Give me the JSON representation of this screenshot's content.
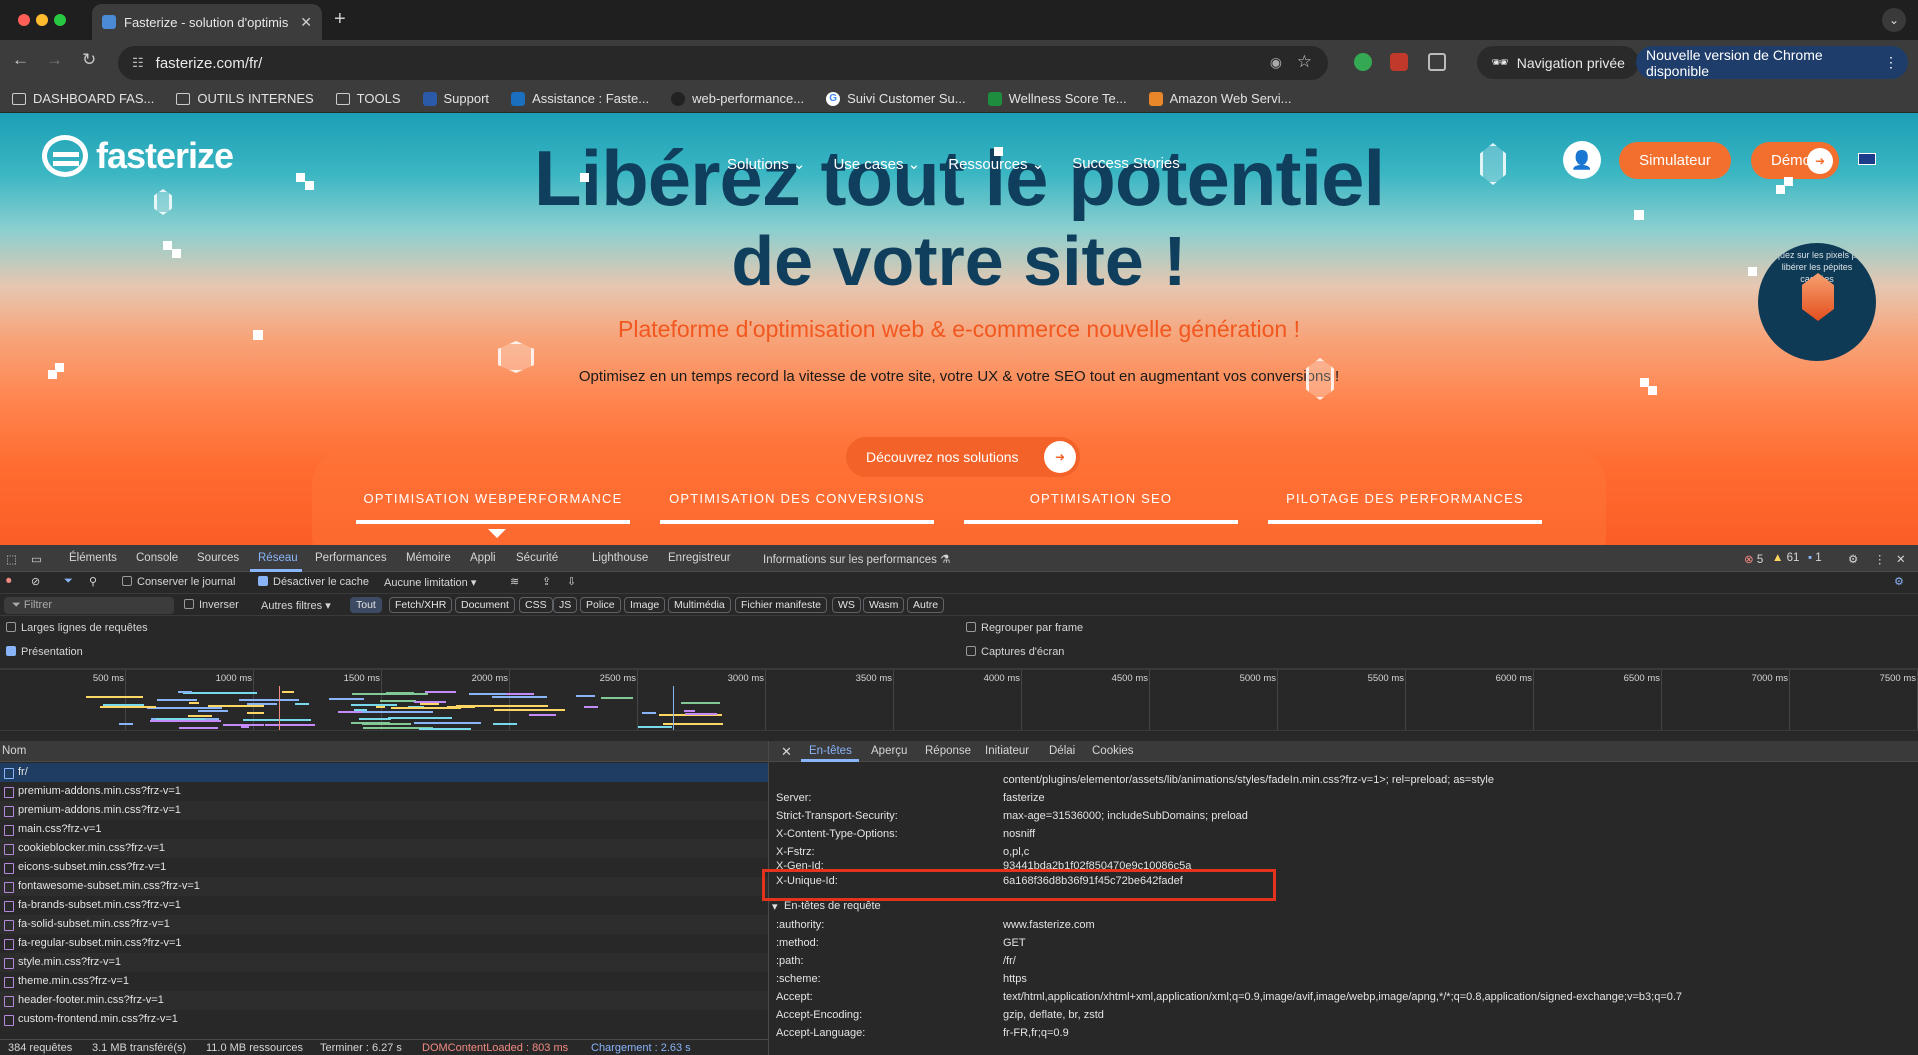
{
  "browser": {
    "tab_title": "Fasterize - solution d'optimis",
    "url": "fasterize.com/fr/",
    "private_label": "Navigation privée",
    "update_label": "Nouvelle version de Chrome disponible",
    "bookmarks": [
      {
        "label": "DASHBOARD FAS...",
        "icon": "folder-icon"
      },
      {
        "label": "OUTILS INTERNES",
        "icon": "folder-icon"
      },
      {
        "label": "TOOLS",
        "icon": "folder-icon"
      },
      {
        "label": "Support",
        "icon": "support-icon"
      },
      {
        "label": "Assistance : Faste...",
        "icon": "assistance-icon"
      },
      {
        "label": "web-performance...",
        "icon": "github-icon"
      },
      {
        "label": "Suivi Customer Su...",
        "icon": "google-icon"
      },
      {
        "label": "Wellness Score Te...",
        "icon": "sheets-icon"
      },
      {
        "label": "Amazon Web Servi...",
        "icon": "aws-icon"
      }
    ]
  },
  "site": {
    "logo": "fasterize",
    "nav": [
      "Solutions",
      "Use cases",
      "Ressources",
      "Success Stories"
    ],
    "simulator": "Simulateur",
    "demo": "Démo",
    "hero_line1": "Libérez tout le potentiel",
    "hero_line2": "de votre site !",
    "tagline": "Plateforme d'optimisation web & e-commerce nouvelle génération !",
    "subtitle": "Optimisez en un temps record la vitesse de votre site, votre UX & votre SEO tout en augmentant vos conversions !",
    "cta": "Découvrez nos solutions",
    "badge_text": "Cliquez sur les pixels pour libérer les pépites cachées",
    "tabs": [
      "OPTIMISATION WEBPERFORMANCE",
      "OPTIMISATION DES CONVERSIONS",
      "OPTIMISATION SEO",
      "PILOTAGE DES PERFORMANCES"
    ],
    "colors": {
      "accent": "#f36f2e",
      "navy": "#0f3f5c"
    }
  },
  "devtools": {
    "tabs": [
      "Éléments",
      "Console",
      "Sources",
      "Réseau",
      "Performances",
      "Mémoire",
      "Appli",
      "Sécurité",
      "Lighthouse",
      "Enregistreur",
      "Informations sur les performances"
    ],
    "errors": "5",
    "warnings": "61",
    "messages": "1",
    "preserve_log": "Conserver le journal",
    "disable_cache": "Désactiver le cache",
    "throttling": "Aucune limitation",
    "filter_placeholder": "Filtrer",
    "invert": "Inverser",
    "other_filters": "Autres filtres",
    "type_chips": [
      "Tout",
      "Fetch/XHR",
      "Document",
      "CSS",
      "JS",
      "Police",
      "Image",
      "Multimédia",
      "Fichier manifeste",
      "WS",
      "Wasm",
      "Autre"
    ],
    "options": {
      "large_rows": "Larges lignes de requêtes",
      "overview": "Présentation",
      "group_by_frame": "Regrouper par frame",
      "screenshots": "Captures d'écran"
    },
    "timeline_ticks": [
      "500 ms",
      "1000 ms",
      "1500 ms",
      "2000 ms",
      "2500 ms",
      "3000 ms",
      "3500 ms",
      "4000 ms",
      "4500 ms",
      "5000 ms",
      "5500 ms",
      "6000 ms",
      "6500 ms",
      "7000 ms",
      "7500 ms"
    ],
    "name_header": "Nom",
    "requests": [
      "fr/",
      "premium-addons.min.css?frz-v=1",
      "premium-addons.min.css?frz-v=1",
      "main.css?frz-v=1",
      "cookieblocker.min.css?frz-v=1",
      "eicons-subset.min.css?frz-v=1",
      "fontawesome-subset.min.css?frz-v=1",
      "fa-brands-subset.min.css?frz-v=1",
      "fa-solid-subset.min.css?frz-v=1",
      "fa-regular-subset.min.css?frz-v=1",
      "style.min.css?frz-v=1",
      "theme.min.css?frz-v=1",
      "header-footer.min.css?frz-v=1",
      "custom-frontend.min.css?frz-v=1"
    ],
    "detail_tabs": [
      "En-têtes",
      "Aperçu",
      "Réponse",
      "Initiateur",
      "Délai",
      "Cookies"
    ],
    "response_headers": [
      {
        "k": "",
        "v": "content/plugins/elementor/assets/lib/animations/styles/fadeIn.min.css?frz-v=1>; rel=preload; as=style"
      },
      {
        "k": "Server:",
        "v": "fasterize"
      },
      {
        "k": "Strict-Transport-Security:",
        "v": "max-age=31536000; includeSubDomains; preload"
      },
      {
        "k": "X-Content-Type-Options:",
        "v": "nosniff"
      },
      {
        "k": "X-Fstrz:",
        "v": "o,pl,c"
      },
      {
        "k": "X-Gen-Id:",
        "v": "93441bda2b1f02f850470e9c10086c5a"
      },
      {
        "k": "X-Unique-Id:",
        "v": "6a168f36d8b36f91f45c72be642fadef"
      }
    ],
    "request_headers_title": "En-têtes de requête",
    "request_headers": [
      {
        "k": ":authority:",
        "v": "www.fasterize.com"
      },
      {
        "k": ":method:",
        "v": "GET"
      },
      {
        "k": ":path:",
        "v": "/fr/"
      },
      {
        "k": ":scheme:",
        "v": "https"
      },
      {
        "k": "Accept:",
        "v": "text/html,application/xhtml+xml,application/xml;q=0.9,image/avif,image/webp,image/apng,*/*;q=0.8,application/signed-exchange;v=b3;q=0.7"
      },
      {
        "k": "Accept-Encoding:",
        "v": "gzip, deflate, br, zstd"
      },
      {
        "k": "Accept-Language:",
        "v": "fr-FR,fr;q=0.9"
      }
    ],
    "status": {
      "requests": "384 requêtes",
      "transferred": "3.1 MB transféré(s)",
      "resources": "11.0 MB ressources",
      "finish": "Terminer : 6.27 s",
      "dcl": "DOMContentLoaded : 803 ms",
      "load": "Chargement : 2.63 s"
    }
  }
}
